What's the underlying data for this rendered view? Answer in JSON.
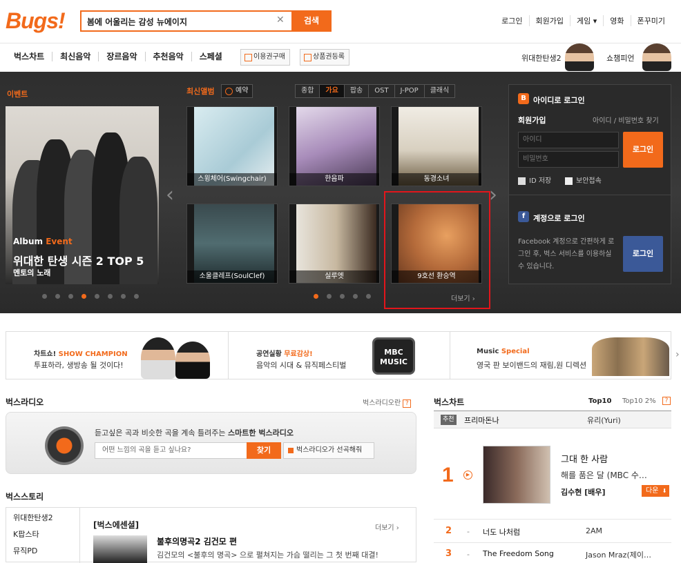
{
  "header": {
    "logo": "Bugs!",
    "search_value": "봄에 어울리는 감성 뉴에이지",
    "search_button": "검색",
    "top_links": [
      "로그인",
      "회원가입",
      "게임 ▾",
      "영화",
      "폰꾸미기"
    ]
  },
  "gnb": {
    "menu": [
      "벅스차트",
      "최신음악",
      "장르음악",
      "추천음악",
      "스페셜"
    ],
    "buy_pass": "이용권구매",
    "gift_register": "상품권등록",
    "promo1": "위대한탄생2",
    "promo2": "쇼챔피언"
  },
  "event": {
    "label": "이벤트",
    "tag_prefix": "Album ",
    "tag_em": "Event",
    "title": "위대한 탄생 시즌 2 TOP 5",
    "subtitle": "멘토의 노래",
    "dots": 8,
    "active_dot": 3
  },
  "new_albums": {
    "label": "최신앨범",
    "reserve": "예약",
    "tabs": [
      "종합",
      "가요",
      "팝송",
      "OST",
      "J-POP",
      "클래식"
    ],
    "active_tab": 1,
    "albums": [
      {
        "name": "스윙체어(Swingchair)",
        "color": "#cde1e6"
      },
      {
        "name": "한음파",
        "color": "#c9b6d3"
      },
      {
        "name": "동경소녀",
        "color": "#8e8060"
      },
      {
        "name": "소울클레프(SoulClef)",
        "color": "#2f4a4f"
      },
      {
        "name": "실루엣",
        "color": "#6a5040"
      },
      {
        "name": "9호선 환승역",
        "color": "#b46a3a"
      }
    ],
    "dots": 5,
    "active_dot": 0,
    "more": "더보기 ›"
  },
  "login": {
    "id_login_title": "아이디로 로그인",
    "join": "회원가입",
    "find": "아이디 / 비밀번호 찾기",
    "id_placeholder": "아이디",
    "pw_placeholder": "비밀번호",
    "login_button": "로그인",
    "save_id": "ID 저장",
    "secure": "보안접속",
    "fb_title": "계정으로 로그인",
    "fb_desc": "Facebook 계정으로 간편하게 로그인 후, 벅스 서비스를 이용하실 수 있습니다.",
    "fb_button": "로그인",
    "colors": {
      "orange": "#f26a1b",
      "fb": "#3b5998"
    }
  },
  "banners": [
    {
      "small_prefix": "차트쇼! ",
      "small_em": "SHOW CHAMPION",
      "text": "투표하라, 생방송 될 것이다!"
    },
    {
      "small_prefix": "공연실황 ",
      "small_em": "무료감상!",
      "text": "음악의 시대 & 뮤직페스티벌",
      "logo": "MBC MUSIC"
    },
    {
      "small_prefix": "Music ",
      "small_em": "Special",
      "text": "영국 판 보이밴드의 재림,원 디렉션"
    }
  ],
  "radio": {
    "title": "벅스라디오",
    "link": "벅스라디오란",
    "desc_plain": "듣고싶은 곡과 비슷한 곡을 계속 틀려주는 ",
    "desc_bold": "스마트한 벅스라디오",
    "placeholder": "어떤 느낌의 곡을 듣고 싶나요?",
    "find": "찾기",
    "pick": "벅스라디오가 선곡해줘"
  },
  "story": {
    "title": "벅스스토리",
    "side": [
      "위대한탄생2",
      "K팝스타",
      "뮤직PD"
    ],
    "headline": "[벅스에센셜]",
    "more": "더보기 ›",
    "item_title": "불후의명곡2 김건모 편",
    "item_desc": "김건모의 <불후의 명곡> 으로 펼쳐지는 가슴 떨리는 그 첫 번째 대결!"
  },
  "chart": {
    "title": "벅스차트",
    "tab1": "Top10",
    "tab2": "Top10 2%",
    "rec_badge": "추천",
    "rec_song": "프리마돈나",
    "rec_artist": "유리(Yuri)",
    "top": {
      "rank": "1",
      "song": "그대 한 사람",
      "album": "해를 품은 달 (MBC 수…",
      "artist": "김수현 [배우]",
      "down": "다운"
    },
    "rows": [
      {
        "rank": "2",
        "change": "-",
        "song": "너도 나처럼",
        "artist": "2AM"
      },
      {
        "rank": "3",
        "change": "-",
        "song": "The Freedom Song",
        "artist": "Jason Mraz(제이…"
      }
    ]
  }
}
